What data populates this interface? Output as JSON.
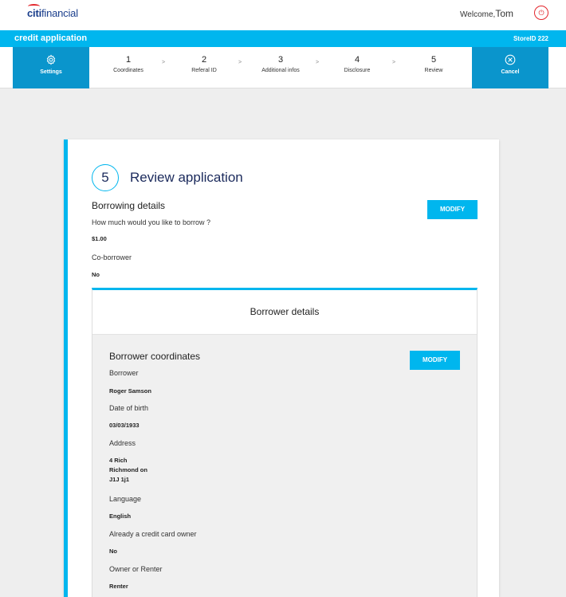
{
  "header": {
    "logo_citi": "citi",
    "logo_financial": "financial",
    "welcome_prefix": "Welcome,",
    "user_name": "Tom",
    "signout_icon": "power-icon"
  },
  "appbar": {
    "title": "credit application",
    "store": "StoreID 222"
  },
  "stepbar": {
    "settings_label": "Settings",
    "cancel_label": "Cancel",
    "steps": [
      {
        "num": "1",
        "label": "Coordinates"
      },
      {
        "num": "2",
        "label": "Referal ID"
      },
      {
        "num": "3",
        "label": "Additional infos"
      },
      {
        "num": "4",
        "label": "Disclosure"
      },
      {
        "num": "5",
        "label": "Review"
      }
    ],
    "separator": ">"
  },
  "review": {
    "step_number": "5",
    "title": "Review application",
    "modify_label": "MODIFY",
    "borrowing": {
      "heading": "Borrowing details",
      "amount_question": "How much would you like to borrow ?",
      "amount_value": "$1.00",
      "coborrower_label": "Co-borrower",
      "coborrower_value": "No"
    },
    "borrower_details_heading": "Borrower details",
    "coordinates": {
      "heading": "Borrower coordinates",
      "borrower_label": "Borrower",
      "borrower_value": "Roger Samson",
      "dob_label": "Date of birth",
      "dob_value": "03/03/1933",
      "address_label": "Address",
      "address_line1": "4 Rich",
      "address_line2": "Richmond on",
      "address_line3": "J1J 1j1",
      "language_label": "Language",
      "language_value": "English",
      "cc_owner_label": "Already a credit card owner",
      "cc_owner_value": "No",
      "owner_renter_label": "Owner or Renter",
      "owner_renter_value": "Renter"
    }
  },
  "colors": {
    "accent": "#00b6ee",
    "accent_dark": "#0a95cc",
    "brand_navy": "#1b2a5c",
    "brand_red": "#e3262c"
  }
}
